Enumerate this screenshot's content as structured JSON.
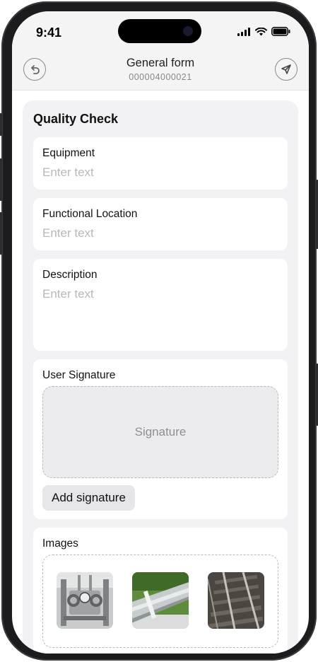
{
  "status_bar": {
    "time": "9:41"
  },
  "header": {
    "title": "General form",
    "subtitle": "000004000021",
    "back_icon": "undo-icon",
    "send_icon": "send-icon"
  },
  "form": {
    "section_title": "Quality Check",
    "fields": [
      {
        "label": "Equipment",
        "placeholder": "Enter text",
        "value": ""
      },
      {
        "label": "Functional Location",
        "placeholder": "Enter text",
        "value": ""
      },
      {
        "label": "Description",
        "placeholder": "Enter text",
        "value": ""
      }
    ],
    "signature": {
      "label": "User Signature",
      "placeholder": "Signature",
      "add_button": "Add signature"
    },
    "images": {
      "label": "Images",
      "items": [
        {
          "icon": "machinery-photo"
        },
        {
          "icon": "pipeline-photo"
        },
        {
          "icon": "railway-track-photo"
        }
      ]
    }
  }
}
